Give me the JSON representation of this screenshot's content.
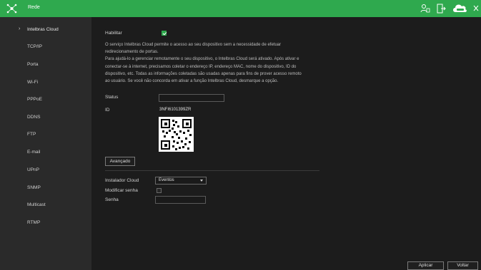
{
  "header": {
    "title": "Rede",
    "icons": [
      "network-icon",
      "user-icon",
      "logout-icon",
      "intelbras-cloud-icon",
      "close-icon"
    ],
    "accent_color": "#2fa94e"
  },
  "sidebar": {
    "items": [
      {
        "label": "Intelbras Cloud",
        "active": true
      },
      {
        "label": "TCP/IP"
      },
      {
        "label": "Porta"
      },
      {
        "label": "Wi-Fi"
      },
      {
        "label": "PPPoE"
      },
      {
        "label": "DDNS"
      },
      {
        "label": "FTP"
      },
      {
        "label": "E-mail"
      },
      {
        "label": "UPnP"
      },
      {
        "label": "SNMP"
      },
      {
        "label": "Multicast"
      },
      {
        "label": "RTMP"
      }
    ]
  },
  "main": {
    "enable_label": "Habilitar",
    "enable_checked": true,
    "description": [
      "O serviço Intelbras Cloud permite o acesso ao seu dispositivo sem a necessidade de efetuar",
      "redirecionamento de portas.",
      "Para ajudá-lo a gerenciar remotamente o seu dispositivo, o Intelbras Cloud será ativado. Após ativar e",
      "conectar-se à internet, precisamos coletar o endereço IP, endereço MAC, nome do dispositivo, ID do",
      "dispositivo, etc. Todas as informações coletadas são usadas apenas para fins de prover acesso remoto",
      "ao usuário. Se você não concorda em ativar a função Intelbras Cloud, desmarque a opção."
    ],
    "status_label": "Status",
    "status_value": "",
    "id_label": "ID",
    "id_value": "3NFI6101399ZR",
    "advanced_button": "Avançado",
    "installer_label": "Instalador Cloud",
    "installer_value": "Eventos",
    "modify_password_label": "Modificar senha",
    "modify_password_checked": false,
    "password_label": "Senha",
    "password_value": ""
  },
  "footer": {
    "apply_button": "Aplicar",
    "back_button": "Voltar"
  }
}
